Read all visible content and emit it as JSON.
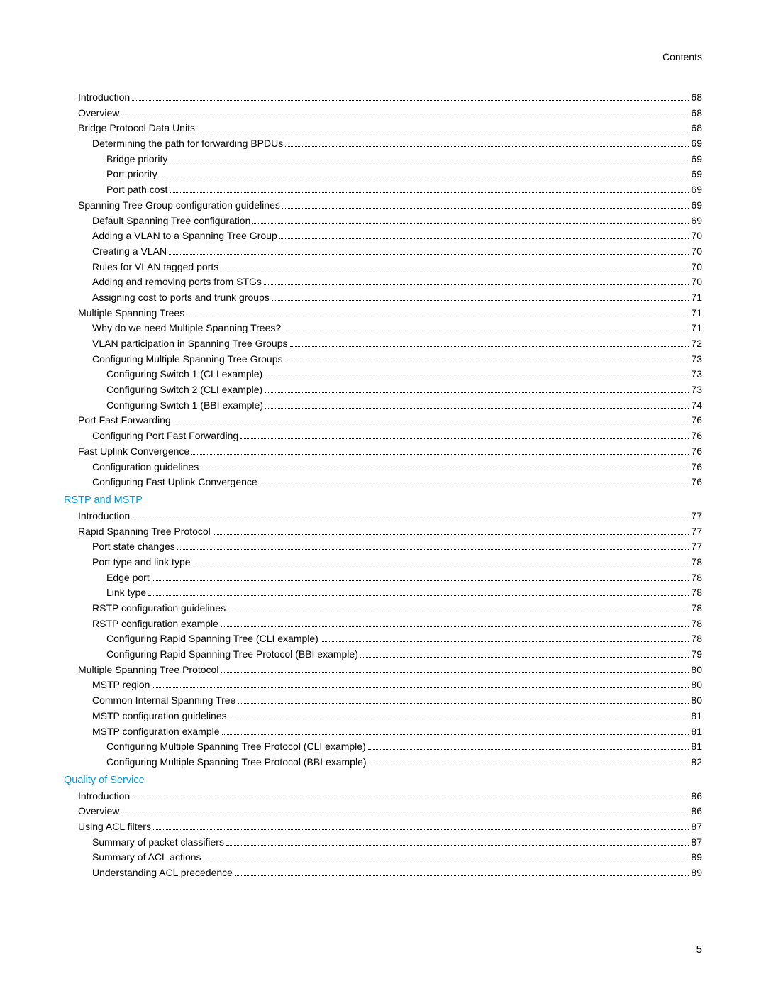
{
  "header": "Contents",
  "pageNumber": "5",
  "sections": [
    {
      "title": null,
      "entries": [
        {
          "label": "Introduction",
          "page": "68",
          "level": 1
        },
        {
          "label": "Overview",
          "page": "68",
          "level": 1
        },
        {
          "label": "Bridge Protocol Data Units",
          "page": "68",
          "level": 1
        },
        {
          "label": "Determining the path for forwarding BPDUs",
          "page": "69",
          "level": 2
        },
        {
          "label": "Bridge priority",
          "page": "69",
          "level": 3
        },
        {
          "label": "Port priority",
          "page": "69",
          "level": 3
        },
        {
          "label": "Port path cost",
          "page": "69",
          "level": 3
        },
        {
          "label": "Spanning Tree Group configuration guidelines",
          "page": "69",
          "level": 1
        },
        {
          "label": "Default Spanning Tree configuration",
          "page": "69",
          "level": 2
        },
        {
          "label": "Adding a VLAN to a Spanning Tree Group",
          "page": "70",
          "level": 2
        },
        {
          "label": "Creating a VLAN",
          "page": "70",
          "level": 2
        },
        {
          "label": "Rules for VLAN tagged ports",
          "page": "70",
          "level": 2
        },
        {
          "label": "Adding and removing ports from STGs",
          "page": "70",
          "level": 2
        },
        {
          "label": "Assigning cost to ports and trunk groups",
          "page": "71",
          "level": 2
        },
        {
          "label": "Multiple Spanning Trees",
          "page": "71",
          "level": 1
        },
        {
          "label": "Why do we need Multiple Spanning Trees?",
          "page": "71",
          "level": 2
        },
        {
          "label": "VLAN participation in Spanning Tree Groups",
          "page": "72",
          "level": 2
        },
        {
          "label": "Configuring Multiple Spanning Tree Groups",
          "page": "73",
          "level": 2
        },
        {
          "label": "Configuring Switch 1 (CLI example)",
          "page": "73",
          "level": 3
        },
        {
          "label": "Configuring Switch 2 (CLI example)",
          "page": "73",
          "level": 3
        },
        {
          "label": "Configuring Switch 1 (BBI example)",
          "page": "74",
          "level": 3
        },
        {
          "label": "Port Fast Forwarding",
          "page": "76",
          "level": 1
        },
        {
          "label": "Configuring Port Fast Forwarding",
          "page": "76",
          "level": 2
        },
        {
          "label": "Fast Uplink Convergence",
          "page": "76",
          "level": 1
        },
        {
          "label": "Configuration guidelines",
          "page": "76",
          "level": 2
        },
        {
          "label": "Configuring Fast Uplink Convergence",
          "page": "76",
          "level": 2
        }
      ]
    },
    {
      "title": "RSTP and MSTP",
      "entries": [
        {
          "label": "Introduction",
          "page": "77",
          "level": 1
        },
        {
          "label": "Rapid Spanning Tree Protocol",
          "page": "77",
          "level": 1
        },
        {
          "label": "Port state changes",
          "page": "77",
          "level": 2
        },
        {
          "label": "Port type and link type",
          "page": "78",
          "level": 2
        },
        {
          "label": "Edge port",
          "page": "78",
          "level": 3
        },
        {
          "label": "Link type",
          "page": "78",
          "level": 3
        },
        {
          "label": "RSTP configuration guidelines",
          "page": "78",
          "level": 2
        },
        {
          "label": "RSTP configuration example",
          "page": "78",
          "level": 2
        },
        {
          "label": "Configuring Rapid Spanning Tree (CLI example)",
          "page": "78",
          "level": 3
        },
        {
          "label": "Configuring Rapid Spanning Tree Protocol (BBI example)",
          "page": "79",
          "level": 3
        },
        {
          "label": "Multiple Spanning Tree Protocol",
          "page": "80",
          "level": 1
        },
        {
          "label": "MSTP region",
          "page": "80",
          "level": 2
        },
        {
          "label": "Common Internal Spanning Tree",
          "page": "80",
          "level": 2
        },
        {
          "label": "MSTP configuration guidelines",
          "page": "81",
          "level": 2
        },
        {
          "label": "MSTP configuration example",
          "page": "81",
          "level": 2
        },
        {
          "label": "Configuring Multiple Spanning Tree Protocol (CLI example)",
          "page": "81",
          "level": 3
        },
        {
          "label": "Configuring Multiple Spanning Tree Protocol (BBI example)",
          "page": "82",
          "level": 3
        }
      ]
    },
    {
      "title": "Quality of Service",
      "entries": [
        {
          "label": "Introduction",
          "page": "86",
          "level": 1
        },
        {
          "label": "Overview",
          "page": "86",
          "level": 1
        },
        {
          "label": "Using ACL filters",
          "page": "87",
          "level": 1
        },
        {
          "label": "Summary of packet classifiers",
          "page": "87",
          "level": 2
        },
        {
          "label": "Summary of ACL actions",
          "page": "89",
          "level": 2
        },
        {
          "label": "Understanding ACL precedence",
          "page": "89",
          "level": 2
        }
      ]
    }
  ]
}
